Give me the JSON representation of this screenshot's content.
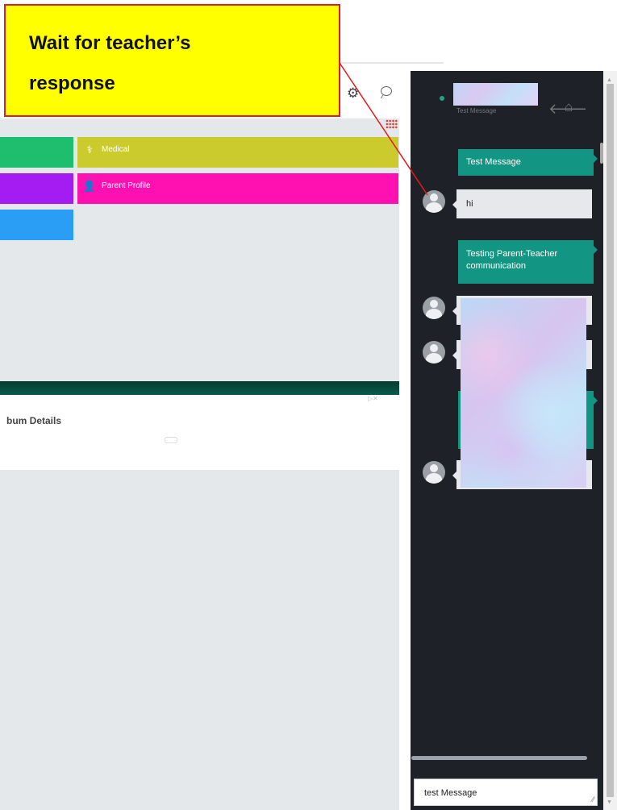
{
  "callout": {
    "line1": "Wait for teacher’s",
    "line2": "response"
  },
  "dashboard": {
    "tiles": [
      {
        "label": "Medical",
        "color": "#cbcb2d",
        "icon": "stethoscope-icon"
      },
      {
        "label": "Parent Profile",
        "color": "#ff10b0",
        "icon": "user-icon"
      }
    ],
    "album": {
      "title": "bum Details",
      "ad_close": "▷✕"
    }
  },
  "chat": {
    "subtitle": "Test Message",
    "messages": [
      {
        "direction": "out",
        "text": "Test Message"
      },
      {
        "direction": "in",
        "text": "hi"
      },
      {
        "direction": "out",
        "text": "Testing Parent-Teacher communication"
      }
    ],
    "input": {
      "value": "test Message"
    }
  },
  "colors": {
    "chat_bg": "#1e2128",
    "outgoing_bubble": "#129683",
    "incoming_bubble": "#e6e8ec",
    "callout_bg": "#ffff00",
    "callout_border": "#e41b1b"
  }
}
